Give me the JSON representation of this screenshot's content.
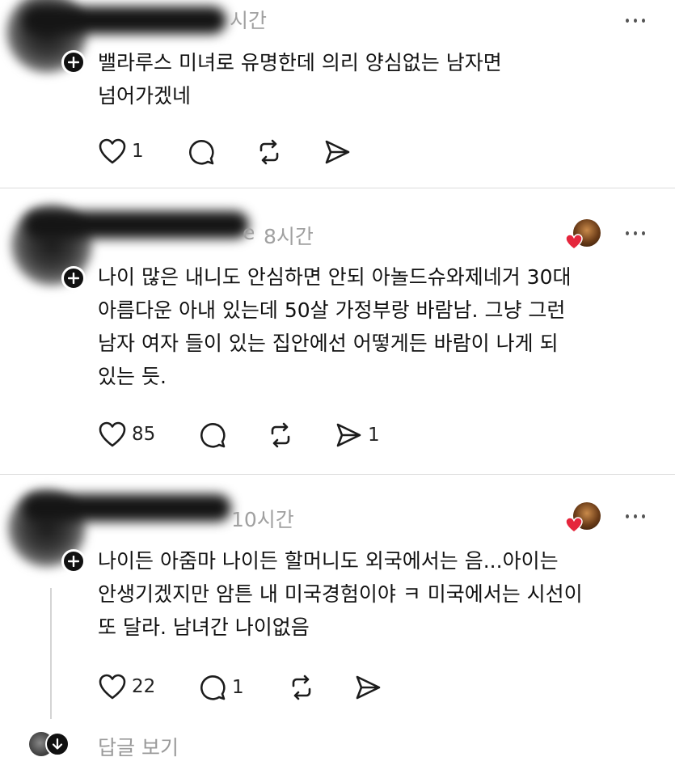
{
  "comments": [
    {
      "time": "시간",
      "body": "밸라루스 미녀로 유명한데 의리 양심없는 남자면\n넘어가겠네",
      "likes": "1",
      "replies": "",
      "reposts": "",
      "shares": ""
    },
    {
      "username_fragment": "e",
      "time": "8시간",
      "body": "나이 많은 내니도 안심하면 안되 아놀드슈와제네거 30대\n아름다운 아내 있는데 50살 가정부랑 바람남. 그냥 그런\n남자 여자 들이 있는 집안에선 어떻게든 바람이 나게 되\n있는 듯.",
      "likes": "85",
      "replies": "",
      "reposts": "",
      "shares": "1"
    },
    {
      "time": "10시간",
      "body": "나이든 아줌마 나이든 할머니도 외국에서는 음...아이는\n안생기겠지만 암튼 내 미국경험이야 ㅋ 미국에서는 시선이\n또 달라. 남녀간 나이없음",
      "likes": "22",
      "replies": "1",
      "reposts": "",
      "shares": ""
    }
  ],
  "view_replies": "답글 보기",
  "icons": {
    "like": "heart-outline-icon",
    "reply": "speech-bubble-icon",
    "repost": "repost-arrows-icon",
    "share": "send-paper-plane-icon",
    "follow": "plus-icon",
    "more": "more-dots-icon",
    "author_liked": "red-heart-icon"
  },
  "colors": {
    "author_like_heart": "#e5263c",
    "meta_text": "#a0a0a0"
  }
}
